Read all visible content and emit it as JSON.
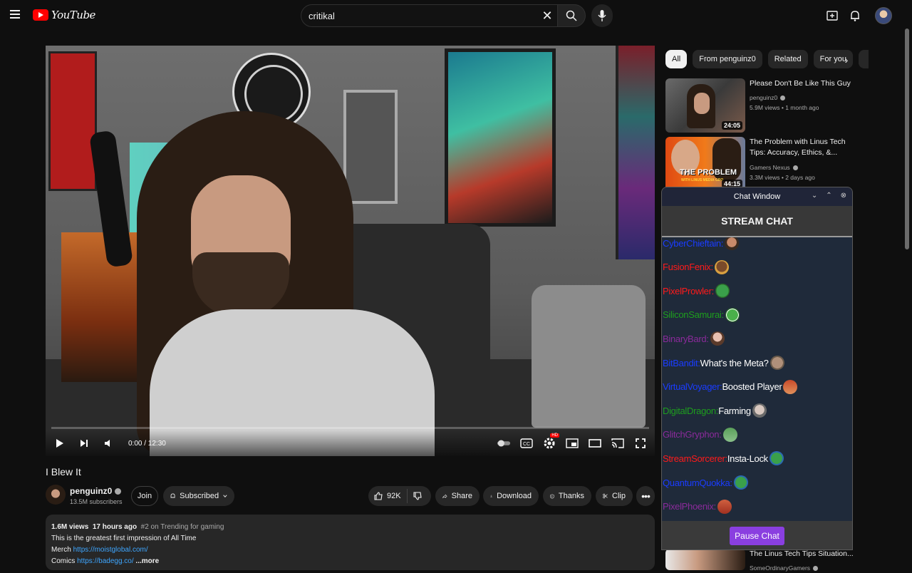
{
  "header": {
    "logo_text": "YouTube",
    "search_value": "critikal"
  },
  "video": {
    "time": "0:00 / 12:30",
    "progress": 0.0,
    "hd_badge": "HD"
  },
  "watch": {
    "title": "I Blew It",
    "channel": "penguinz0",
    "subscribers": "13.5M subscribers",
    "join_label": "Join",
    "subscribed_label": "Subscribed",
    "likes": "92K",
    "share_label": "Share",
    "download_label": "Download",
    "thanks_label": "Thanks",
    "clip_label": "Clip",
    "desc_views": "1.6M views",
    "desc_time": "17 hours ago",
    "desc_trending": "#2 on Trending for gaming",
    "desc_line1": "This is the greatest first impression of All Time",
    "desc_merch_label": "Merch",
    "desc_merch_link": "https://moistglobal.com/",
    "desc_comics_label": "Comics",
    "desc_comics_link": "https://badegg.co/",
    "desc_more": "...more"
  },
  "sidebar": {
    "chips": [
      "All",
      "From penguinz0",
      "Related",
      "For you"
    ],
    "recs": [
      {
        "title": "Please Don't Be Like This Guy",
        "channel": "penguinz0",
        "meta": "5.9M views • 1 month ago",
        "duration": "24:05"
      },
      {
        "title": "The Problem with Linus Tech Tips: Accuracy, Ethics, &...",
        "channel": "Gamers Nexus",
        "meta": "3.3M views • 2 days ago",
        "duration": "44:15"
      },
      {
        "title": "The Linus Tech Tips Situation...",
        "channel": "SomeOrdinaryGamers",
        "meta": "",
        "duration": ""
      }
    ],
    "thumb_overlay_text": "THE PROBLEM",
    "thumb_overlay_sub": "WITH LINUS MEDIA GRO"
  },
  "chat": {
    "window_title": "Chat Window",
    "header": "STREAM CHAT",
    "pause_label": "Pause Chat",
    "messages": [
      {
        "user": "CyberChieftain:",
        "text": "",
        "color": "#1a3cff"
      },
      {
        "user": "FusionFenix:",
        "text": "",
        "color": "#ff1a1a"
      },
      {
        "user": "PixelProwler:",
        "text": "",
        "color": "#ff1a1a"
      },
      {
        "user": "SiliconSamurai:",
        "text": "",
        "color": "#1e9e1e"
      },
      {
        "user": "BinaryBard:",
        "text": "",
        "color": "#8a2a9a"
      },
      {
        "user": "BitBandit:",
        "text": "What's the Meta?",
        "color": "#1a3cff"
      },
      {
        "user": "VirtualVoyager:",
        "text": "Boosted Player",
        "color": "#1a3cff"
      },
      {
        "user": "DigitalDragon:",
        "text": "Farming",
        "color": "#1e9e1e"
      },
      {
        "user": "GlitchGryphon:",
        "text": "",
        "color": "#8a2a9a"
      },
      {
        "user": "StreamSorcerer:",
        "text": "Insta-Lock",
        "color": "#ff1a1a"
      },
      {
        "user": "QuantumQuokka:",
        "text": "",
        "color": "#1a3cff"
      },
      {
        "user": "PixelPhoenix:",
        "text": "",
        "color": "#8a2a9a"
      }
    ]
  }
}
